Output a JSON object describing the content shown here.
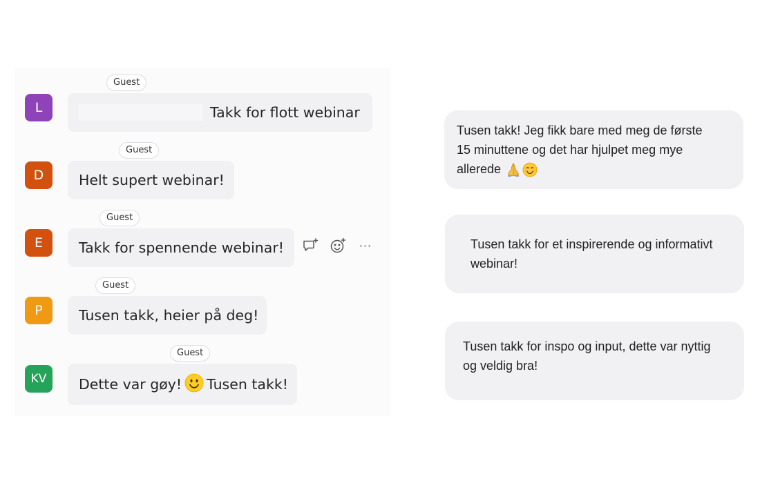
{
  "chat": {
    "messages": [
      {
        "initials": "L",
        "avatar_color": "#8e43b9",
        "tag": "Guest",
        "text": "Takk for flott webinar",
        "redacted_prefix": true
      },
      {
        "initials": "D",
        "avatar_color": "#d3510f",
        "tag": "Guest",
        "text": "Helt supert webinar!"
      },
      {
        "initials": "E",
        "avatar_color": "#d3510f",
        "tag": "Guest",
        "text": "Takk for spennende webinar!"
      },
      {
        "initials": "P",
        "avatar_color": "#f09a14",
        "tag": "Guest",
        "text": "Tusen takk, heier på deg!"
      },
      {
        "initials": "KV",
        "avatar_color": "#25a35a",
        "tag": "Guest",
        "text_before": "Dette var gøy!",
        "emoji": "smiley-emoji",
        "text_after": "Tusen takk!"
      }
    ],
    "hover_actions": [
      {
        "icon": "reply-icon"
      },
      {
        "icon": "add-reaction-icon"
      },
      {
        "icon": "more-options-icon",
        "label": "···"
      }
    ]
  },
  "cards": [
    {
      "lines": [
        "Tusen takk! Jeg fikk bare med meg de første",
        "15 minuttene og det har hjulpet meg mye",
        "allerede"
      ],
      "emojis": [
        "folded-hands-emoji",
        "smiling-face-emoji"
      ]
    },
    {
      "lines": [
        "Tusen takk for et inspirerende og informativt",
        "webinar!"
      ]
    },
    {
      "lines": [
        "Tusen takk for inspo og input, dette var nyttig",
        "og veldig bra!"
      ]
    }
  ],
  "colors": {
    "bubble_bg": "#f1f1f4",
    "panel_bg": "#fbfbfc"
  }
}
